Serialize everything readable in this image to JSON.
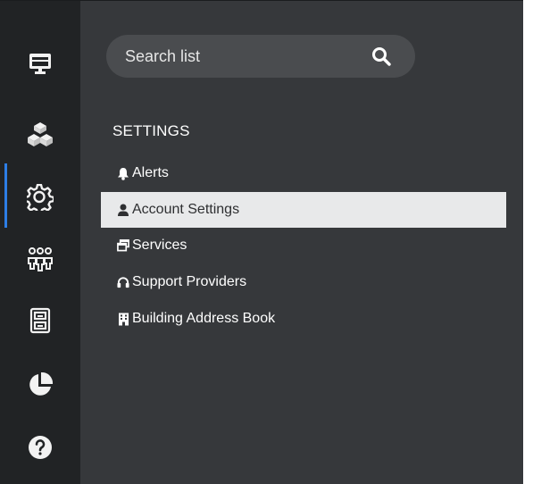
{
  "search": {
    "placeholder": "Search list"
  },
  "rail": {
    "items": [
      {
        "icon": "monitor-icon"
      },
      {
        "icon": "boxes-icon"
      },
      {
        "icon": "gear-icon",
        "active": true
      },
      {
        "icon": "users-icon"
      },
      {
        "icon": "file-cabinet-icon"
      },
      {
        "icon": "pie-chart-icon"
      },
      {
        "icon": "help-icon"
      }
    ]
  },
  "settings": {
    "title": "SETTINGS",
    "items": [
      {
        "label": "Alerts",
        "icon": "bell-icon"
      },
      {
        "label": "Account Settings",
        "icon": "user-icon",
        "selected": true
      },
      {
        "label": "Services",
        "icon": "windows-icon"
      },
      {
        "label": "Support Providers",
        "icon": "headphones-icon"
      },
      {
        "label": "Building Address Book",
        "icon": "building-icon"
      }
    ]
  },
  "colors": {
    "rail_bg": "#212325",
    "panel_bg": "#36383b",
    "accent": "#2d7ee6",
    "selected_bg": "#e8e9ea"
  }
}
